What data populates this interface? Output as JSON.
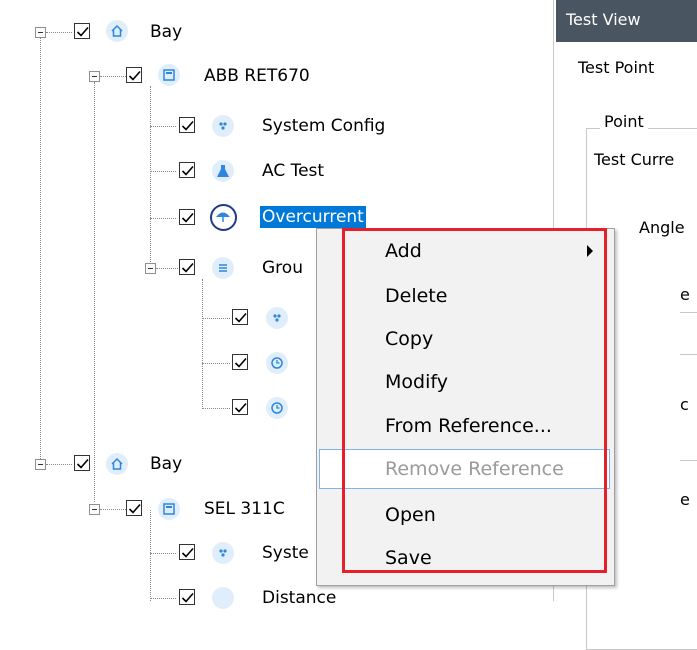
{
  "tree": {
    "items": [
      {
        "label": "Bay",
        "level": 0,
        "icon": "bay-home-icon"
      },
      {
        "label": "ABB RET670",
        "level": 1,
        "icon": "device-icon"
      },
      {
        "label": "System Config",
        "level": 2,
        "icon": "system-config-icon"
      },
      {
        "label": "AC Test",
        "level": 2,
        "icon": "ac-test-flask-icon"
      },
      {
        "label": "Overcurrent",
        "level": 2,
        "icon": "overcurrent-umbrella-icon",
        "selected": true
      },
      {
        "label": "Grou",
        "level": 2,
        "icon": "group-list-icon"
      },
      {
        "label": "",
        "level": 3,
        "icon": "system-config-icon"
      },
      {
        "label": "",
        "level": 3,
        "icon": "clock-icon"
      },
      {
        "label": "",
        "level": 3,
        "icon": "clock-icon"
      },
      {
        "label": "Bay",
        "level": 0,
        "icon": "bay-home-icon"
      },
      {
        "label": "SEL 311C",
        "level": 1,
        "icon": "device-icon"
      },
      {
        "label": "Syste",
        "level": 2,
        "icon": "system-config-icon"
      },
      {
        "label": "Distance",
        "level": 2,
        "icon": "distance-icon"
      }
    ]
  },
  "right_panel": {
    "header": "Test View",
    "test_point": "Test Point",
    "point_group": "Point",
    "test_current": "Test Curre",
    "angle": "Angle",
    "fragment_e1": "e",
    "fragment_c": "c",
    "fragment_e2": "e"
  },
  "context_menu": {
    "items": [
      {
        "label": "Add",
        "submenu": true,
        "enabled": true
      },
      {
        "label": "Delete",
        "enabled": true
      },
      {
        "label": "Copy",
        "enabled": true
      },
      {
        "label": "Modify",
        "enabled": true
      },
      {
        "label": "From Reference...",
        "enabled": true
      },
      {
        "label": "Remove Reference",
        "enabled": false,
        "highlighted": true
      },
      {
        "label": "Open",
        "enabled": true
      },
      {
        "label": "Save",
        "enabled": true
      }
    ]
  },
  "colors": {
    "selection": "#0078d7",
    "header_bg": "#4a5562",
    "annotation_red": "#e5202b",
    "hover_border": "#7eb4ea"
  }
}
